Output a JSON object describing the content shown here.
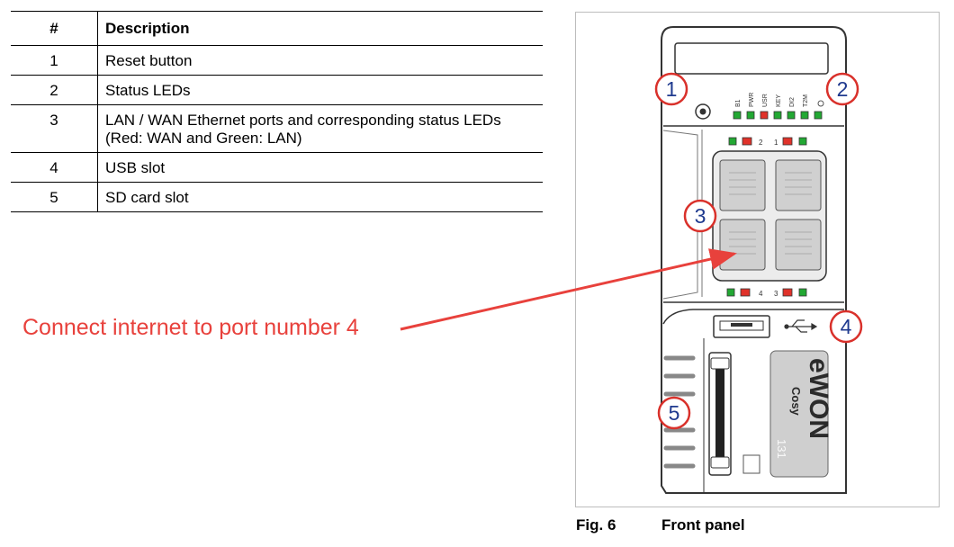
{
  "table": {
    "header": {
      "num": "#",
      "desc": "Description"
    },
    "rows": [
      {
        "num": "1",
        "desc": "Reset button"
      },
      {
        "num": "2",
        "desc": "Status LEDs"
      },
      {
        "num": "3",
        "desc": "LAN / WAN Ethernet ports and corresponding status LEDs (Red: WAN and Green: LAN)"
      },
      {
        "num": "4",
        "desc": "USB slot"
      },
      {
        "num": "5",
        "desc": "SD card slot"
      }
    ]
  },
  "callout": {
    "text": "Connect internet to port number 4",
    "color": "#e8413c"
  },
  "figure": {
    "label": "Fig. 6",
    "title": "Front panel",
    "markers": [
      "1",
      "2",
      "3",
      "4",
      "5"
    ],
    "led_labels": [
      "B1",
      "PWR",
      "USR",
      "KEY",
      "DI2",
      "T2M"
    ],
    "port_numbers": [
      "2",
      "1",
      "4",
      "3"
    ],
    "brand": "eWON",
    "model": "Cosy",
    "model_number": "131",
    "colors": {
      "led_green": "#22a833",
      "led_red": "#e0322a",
      "marker_red": "#d9312b",
      "marker_text": "#1f3a8f"
    }
  }
}
